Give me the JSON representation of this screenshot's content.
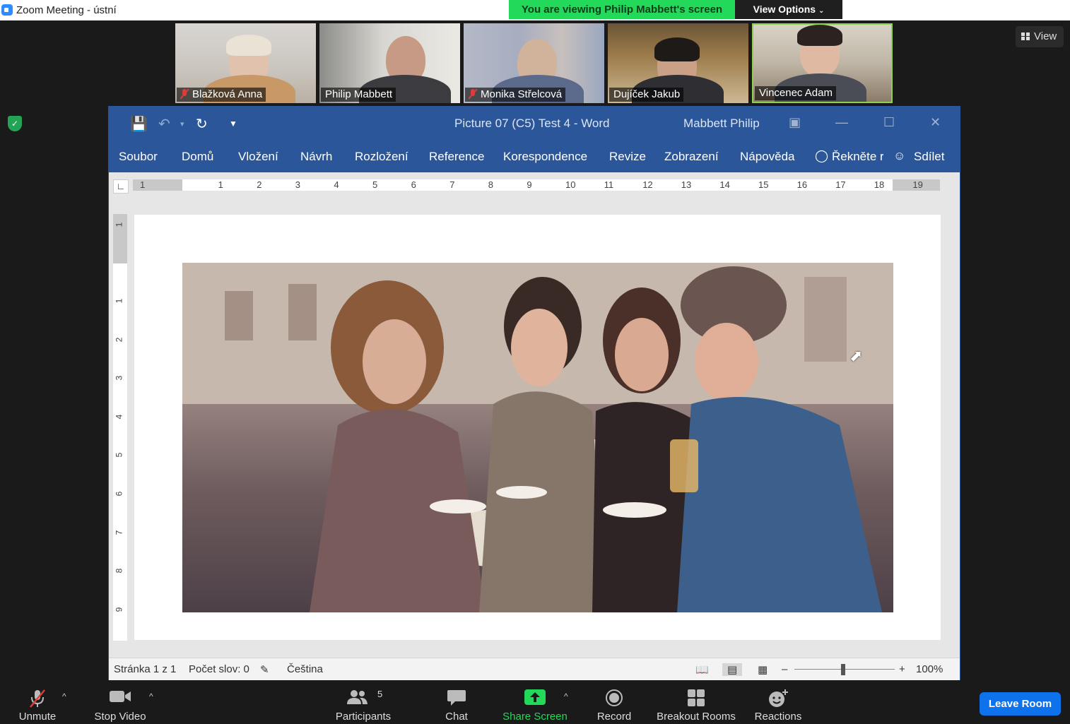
{
  "window": {
    "title": "Zoom Meeting - ústní"
  },
  "banner": {
    "viewing": "You are viewing Philip Mabbett's screen",
    "view_options": "View Options"
  },
  "view_button": {
    "label": "View"
  },
  "participants": [
    {
      "name": "Blažková Anna",
      "muted": true
    },
    {
      "name": "Philip Mabbett",
      "muted": false
    },
    {
      "name": "Monika Střelcová",
      "muted": true
    },
    {
      "name": "Dujíček Jakub",
      "muted": false
    },
    {
      "name": "Vincenec Adam",
      "muted": false,
      "active": true
    }
  ],
  "word": {
    "doc_title": "Picture 07 (C5) Test 4  -  Word",
    "owner": "Mabbett Philip",
    "tabs": [
      "Soubor",
      "Domů",
      "Vložení",
      "Návrh",
      "Rozložení",
      "Reference",
      "Korespondence",
      "Revize",
      "Zobrazení",
      "Nápověda"
    ],
    "tell_me": "Řekněte r",
    "share": "Sdílet",
    "hruler_numbers": [
      "1",
      "1",
      "2",
      "3",
      "4",
      "5",
      "6",
      "7",
      "8",
      "9",
      "10",
      "11",
      "12",
      "13",
      "14",
      "15",
      "16",
      "17",
      "18",
      "19"
    ],
    "vruler_numbers": [
      "1",
      "1",
      "2",
      "3",
      "4",
      "5",
      "6",
      "7",
      "8",
      "9"
    ],
    "status": {
      "page": "Stránka 1 z 1",
      "words": "Počet slov: 0",
      "language": "Čeština",
      "zoom": "100%"
    }
  },
  "toolbar": {
    "unmute": "Unmute",
    "stop_video": "Stop Video",
    "participants": "Participants",
    "participants_count": "5",
    "chat": "Chat",
    "share_screen": "Share Screen",
    "record": "Record",
    "breakout_rooms": "Breakout Rooms",
    "reactions": "Reactions",
    "leave": "Leave Room"
  },
  "colors": {
    "word_blue": "#2b579a",
    "zoom_green": "#23d959",
    "zoom_blue": "#0e72ed",
    "mute_red": "#e03b3b"
  }
}
